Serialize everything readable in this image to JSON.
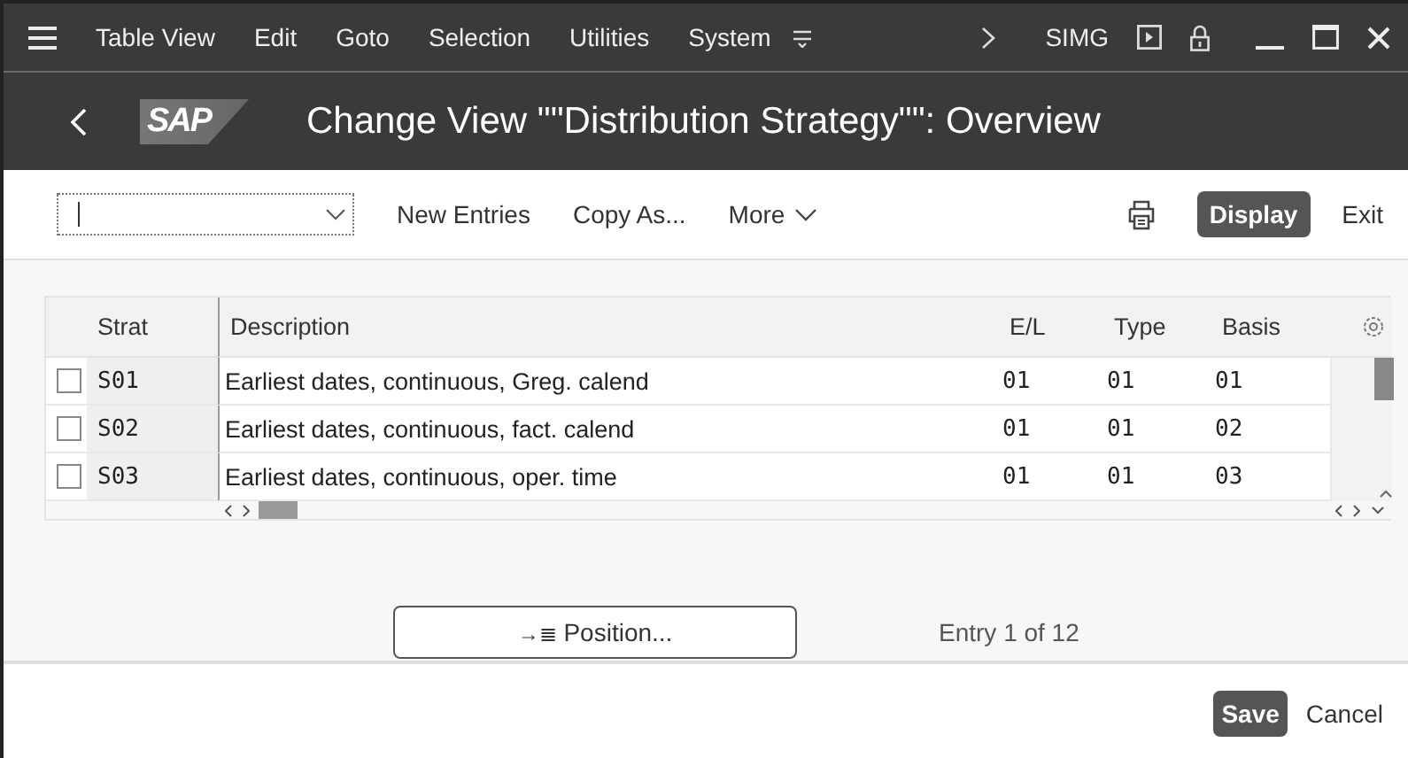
{
  "menu_bar": {
    "items": [
      "Table View",
      "Edit",
      "Goto",
      "Selection",
      "Utilities",
      "System"
    ],
    "transaction": "SIMG"
  },
  "title_bar": {
    "logo": "SAP",
    "title": "Change View \"\"Distribution Strategy\"\": Overview"
  },
  "toolbar": {
    "buttons": [
      "New Entries",
      "Copy As...",
      "More"
    ],
    "primary": "Display",
    "exit": "Exit"
  },
  "table": {
    "columns": [
      "Strat",
      "Description",
      "E/L",
      "Type",
      "Basis"
    ],
    "rows": [
      {
        "checked": false,
        "cells": [
          "S01",
          "Earliest dates, continuous, Greg. calend",
          "01",
          "01",
          "01"
        ]
      },
      {
        "checked": false,
        "cells": [
          "S02",
          "Earliest dates, continuous, fact. calend",
          "01",
          "01",
          "02"
        ]
      },
      {
        "checked": false,
        "cells": [
          "S03",
          "Earliest dates, continuous, oper. time",
          "01",
          "01",
          "03"
        ]
      }
    ]
  },
  "position_button": {
    "icon": "→≣",
    "label": "Position..."
  },
  "entry_info": "Entry 1 of 12",
  "footer": {
    "save": "Save",
    "cancel": "Cancel"
  }
}
